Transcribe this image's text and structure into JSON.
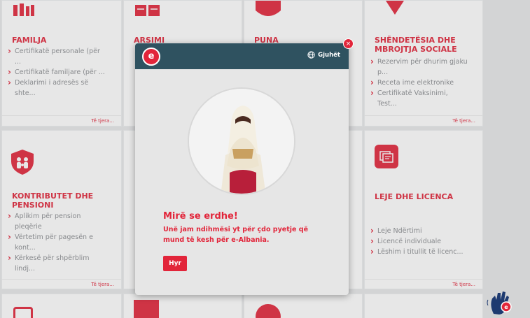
{
  "colors": {
    "accent": "#e2253a",
    "header": "#2f5260",
    "page_bg": "#e7e8ea"
  },
  "cards": {
    "familja": {
      "title": "FAMILJA",
      "links": [
        "Certifikatë personale (për ...",
        "Certifikatë familjare (për ...",
        "Deklarimi i adresës së shte..."
      ],
      "more": "Të tjera..."
    },
    "arsimi": {
      "title": "ARSIMI"
    },
    "puna": {
      "title": "PUNA"
    },
    "shendetesia": {
      "title": "SHËNDETËSIA DHE MBROJTJA SOCIALE",
      "links": [
        "Rezervim për dhurim gjaku p...",
        "Receta ime elektronike",
        "Certifikatë Vaksinimi, Test..."
      ],
      "more": "Të tjera..."
    },
    "kontributet": {
      "title": "KONTRIBUTET DHE PENSIONI",
      "links": [
        "Aplikim për pension pleqërie",
        "Vërtetim për pagesën e kont...",
        "Kërkesë për shpërblim lindj..."
      ],
      "more": "Të tjera..."
    },
    "leje": {
      "title": "LEJE DHE LICENCA",
      "links": [
        "Leje Ndërtimi",
        "Licencë individuale",
        "Lëshim i titullit të licenc..."
      ],
      "more": "Të tjera..."
    }
  },
  "modal": {
    "logo_letter": "e",
    "language_label": "Gjuhët",
    "close_symbol": "×",
    "welcome": "Mirë se erdhe!",
    "intro": "Unë jam ndihmësi yt për çdo pyetje që mund të kesh për e-Albania.",
    "enter_button": "Hyr"
  },
  "icons": {
    "familja": "family-icon",
    "arsimi": "book-icon",
    "puna": "briefcase-icon",
    "shendetesia": "heart-icon",
    "kontributet": "shield-family-icon",
    "leje": "document-icon",
    "assistant": "assistant-hand-icon"
  }
}
